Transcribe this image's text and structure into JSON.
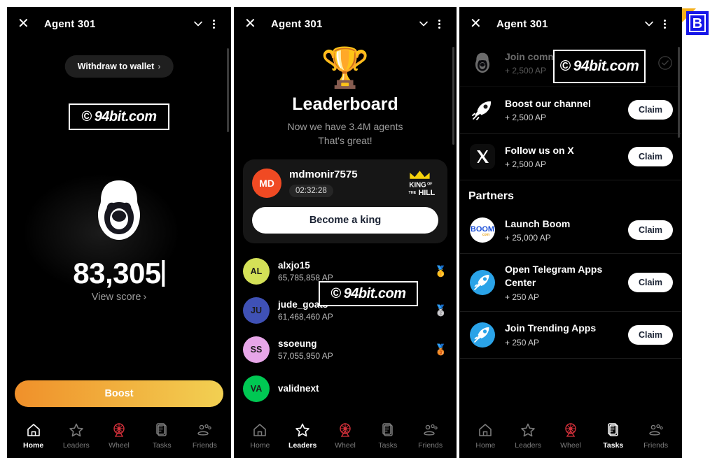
{
  "colors": {
    "accent_orange": "#F0902A",
    "accent_yellow": "#F2D052",
    "background": "#000000",
    "card": "#161616",
    "claim_text": "#1a2233",
    "wheel_red": "#D3303A"
  },
  "watermark": {
    "symbol": "©",
    "text": "94bit.com"
  },
  "corner_logo": {
    "letter": "B",
    "name": "b-logo-badge"
  },
  "topbar": {
    "close_label": "✕",
    "title": "Agent 301",
    "chevron_name": "chevron-down-icon",
    "menu_name": "more-options-icon"
  },
  "nav": {
    "items": [
      {
        "label": "Home",
        "icon": "home-icon"
      },
      {
        "label": "Leaders",
        "icon": "star-icon"
      },
      {
        "label": "Wheel",
        "icon": "ferris-wheel-icon"
      },
      {
        "label": "Tasks",
        "icon": "clipboard-icon"
      },
      {
        "label": "Friends",
        "icon": "friends-icon"
      }
    ],
    "active_panel1": "Home",
    "active_panel2": "Leaders",
    "active_panel3": "Tasks"
  },
  "panel1": {
    "withdraw_label": "Withdraw to wallet",
    "withdraw_chevron": "›",
    "logo_name": "ape-logo",
    "score": "83,305",
    "view_score_label": "View score",
    "view_score_chevron": "›",
    "boost_label": "Boost"
  },
  "panel2": {
    "trophy_icon": "🏆",
    "title": "Leaderboard",
    "subtitle_line1": "Now we have 3.4M agents",
    "subtitle_line2": "That's great!",
    "king_card": {
      "avatar_initials": "MD",
      "avatar_color": "#F04A23",
      "username": "mdmonir7575",
      "timer": "02:32:28",
      "badge_name": "king-of-the-hill-badge",
      "badge_line1": "KING",
      "badge_line2": "OF THE",
      "badge_line3": "HILL",
      "button_label": "Become a king"
    },
    "leaders": [
      {
        "initials": "AL",
        "color": "#D4E157",
        "name": "alxjo15",
        "ap": "65,785,858 AP",
        "medal": "🥇"
      },
      {
        "initials": "JU",
        "color": "#3F51B5",
        "name": "jude_goats",
        "ap": "61,468,460 AP",
        "medal": "🥈"
      },
      {
        "initials": "SS",
        "color": "#E7A6E8",
        "name": "ssoeung",
        "ap": "57,055,950 AP",
        "medal": "🥉"
      },
      {
        "initials": "VA",
        "color": "#00C853",
        "name": "validnext",
        "ap": "",
        "medal": ""
      }
    ]
  },
  "panel3": {
    "partners_heading": "Partners",
    "claim_label": "Claim",
    "tasks": [
      {
        "name": "Join community",
        "ap": "+ 2,500 AP",
        "icon": "ape-logo-icon",
        "state": "done"
      },
      {
        "name": "Boost our channel",
        "ap": "+ 2,500 AP",
        "icon": "rocket-icon",
        "state": "claim"
      },
      {
        "name": "Follow us on X",
        "ap": "+ 2,500 AP",
        "icon": "x-logo-icon",
        "state": "claim"
      }
    ],
    "partners": [
      {
        "name": "Launch Boom",
        "ap": "+ 25,000 AP",
        "icon": "boom-coin-icon",
        "state": "claim"
      },
      {
        "name": "Open Telegram Apps Center",
        "ap": "+ 250 AP",
        "icon": "telegram-rocket-icon",
        "state": "claim"
      },
      {
        "name": "Join Trending Apps",
        "ap": "+ 250 AP",
        "icon": "telegram-rocket-icon",
        "state": "claim"
      }
    ]
  }
}
